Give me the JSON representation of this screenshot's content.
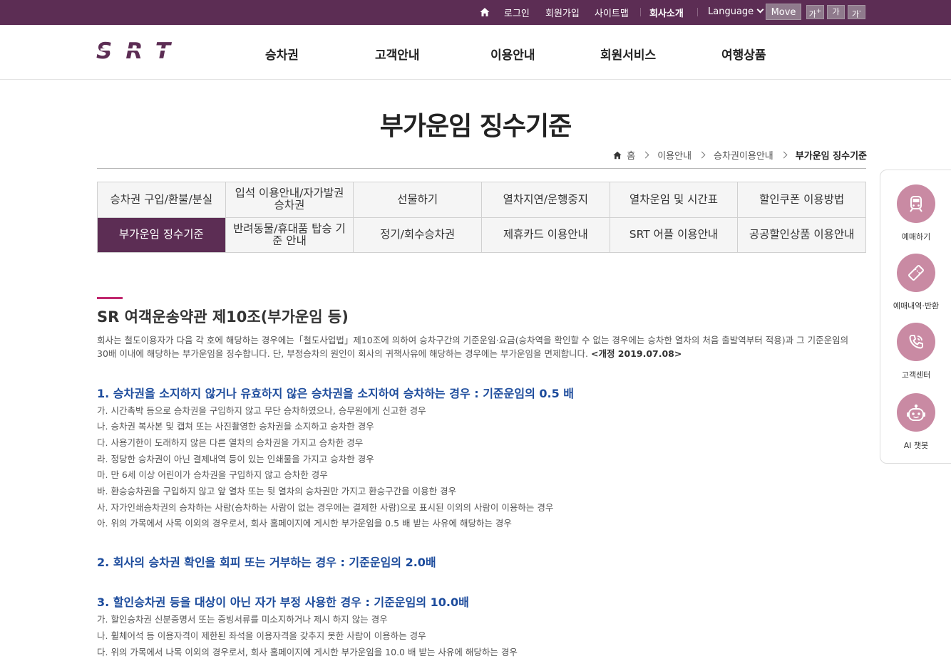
{
  "topbar": {
    "login": "로그인",
    "join": "회원가입",
    "sitemap": "사이트맵",
    "company": "회사소개",
    "language": "Language",
    "move": "Move",
    "font_up": "가",
    "font_up_sup": "+",
    "font_normal": "가",
    "font_down": "가",
    "font_down_sup": "-"
  },
  "header": {
    "logo_text": "SRT",
    "gnb": [
      "승차권",
      "고객안내",
      "이용안내",
      "회원서비스",
      "여행상품"
    ]
  },
  "page": {
    "title": "부가운임 징수기준",
    "breadcrumb": [
      "홈",
      "이용안내",
      "승차권이용안내",
      "부가운임 징수기준"
    ]
  },
  "tabs": [
    {
      "label": "승차권 구입/환불/분실",
      "active": false
    },
    {
      "label": "입석 이용안내/자가발권 승차권",
      "active": false
    },
    {
      "label": "선물하기",
      "active": false
    },
    {
      "label": "열차지연/운행중지",
      "active": false
    },
    {
      "label": "열차운임 및 시간표",
      "active": false
    },
    {
      "label": "할인쿠폰 이용방법",
      "active": false
    },
    {
      "label": "부가운임 징수기준",
      "active": true
    },
    {
      "label": "반려동물/휴대품 탑승 기준 안내",
      "active": false
    },
    {
      "label": "정기/회수승차권",
      "active": false
    },
    {
      "label": "제휴카드 이용안내",
      "active": false
    },
    {
      "label": "SRT 어플 이용안내",
      "active": false
    },
    {
      "label": "공공할인상품 이용안내",
      "active": false
    }
  ],
  "content": {
    "section_title": "SR 여객운송약관 제10조(부가운임 등)",
    "intro_line1": "회사는 철도이용자가 다음 각 호에 해당하는 경우에는「철도사업법」제10조에 의하여 승차구간의 기준운임·요금(승차역을 확인할 수 없는 경우에는 승차한 열차의 처음 출발역부터 적용)과 그 기준운임의",
    "intro_line2": "30배 이내에 해당하는 부가운임을 징수합니다. 단, 부정승차의 원인이 회사의 귀책사유에 해당하는 경우에는 부가운임을 면제합니다. ",
    "intro_revision": "<개정 2019.07.08>",
    "heading1": "1. 승차권을 소지하지 않거나 유효하지 않은 승차권을 소지하여 승차하는 경우 : 기준운임의 0.5 배",
    "items1": [
      "가. 시간촉박 등으로 승차권을 구입하지 않고 무단 승차하였으나, 승무원에게 신고한 경우",
      "나. 승차권 복사본 및 캡쳐 또는 사진촬영한 승차권을 소지하고 승차한 경우",
      "다. 사용기한이 도래하지 않은 다른 열차의 승차권을 가지고 승차한 경우",
      "라. 정당한 승차권이 아닌 결제내역 등이 있는 인쇄물을 가지고 승차한 경우",
      "마. 만 6세 이상 어린이가 승차권을 구입하지 않고 승차한 경우",
      "바. 환승승차권을 구입하지 않고 앞 열차 또는 뒷 열차의 승차권만 가지고 환승구간을 이용한 경우",
      "사. 자가인쇄승차권의 승차하는 사람(승차하는 사람이 없는 경우에는 결제한 사람)으로 표시된 이외의 사람이 이용하는 경우",
      "아. 위의 가목에서 사목 이외의 경우로서, 회사 홈페이지에 게시한 부가운임을 0.5 배 받는 사유에 해당하는 경우"
    ],
    "heading2": "2. 회사의 승차권 확인을 회피 또는 거부하는 경우 : 기준운임의 2.0배",
    "heading3": "3. 할인승차권 등을 대상이 아닌 자가 부정 사용한 경우 : 기준운임의 10.0배",
    "items3": [
      "가. 할인승차권 신분증명서 또는 증빙서류를 미소지하거나 제시 하지 않는 경우",
      "나. 휠체어석 등 이용자격이 제한된 좌석을 이용자격을 갖추지 못한 사람이 이용하는 경우",
      "다. 위의 가목에서 나목 이외의 경우로서, 회사 홈페이지에 게시한 부가운임을 10.0 배 받는 사유에 해당하는 경우"
    ]
  },
  "quick_menu": [
    {
      "label": "예매하기",
      "icon": "train-icon"
    },
    {
      "label": "예매내역·반환",
      "icon": "ticket-icon"
    },
    {
      "label": "고객센터",
      "icon": "phone-icon"
    },
    {
      "label": "AI 챗봇",
      "icon": "chatbot-icon"
    }
  ],
  "colors": {
    "brand_purple": "#5c2d54",
    "accent_pink": "#c0266d",
    "heading_blue": "#1c4b9c",
    "quick_circle": "#c98aa3"
  }
}
